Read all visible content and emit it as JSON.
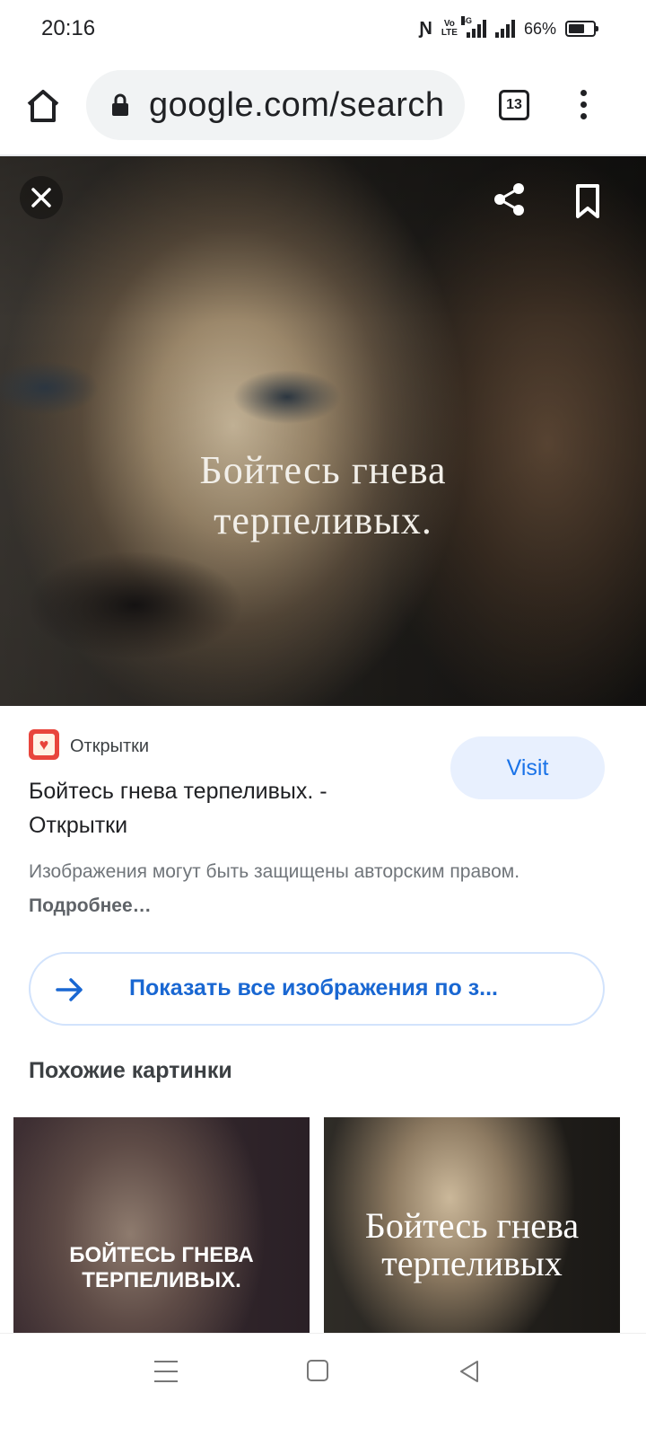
{
  "status_bar": {
    "time": "20:16",
    "network_label": "4G",
    "volte_label_top": "Vo",
    "volte_label_bottom": "LTE",
    "battery_text": "66%",
    "battery_level": 0.66
  },
  "browser": {
    "url_text": "google.com/search",
    "tab_count": "13",
    "icons": {
      "home": "home-icon",
      "lock": "lock-icon",
      "menu": "more-vert-icon"
    }
  },
  "image_viewer": {
    "caption_line1": "Бойтесь гнева",
    "caption_line2": "терпеливых.",
    "icons": {
      "close": "close-icon",
      "share": "share-icon",
      "save": "bookmark-icon"
    }
  },
  "result": {
    "source_name": "Открытки",
    "title": "Бойтесь гнева терпеливых. - Открытки",
    "visit_label": "Visit",
    "copyright_text": "Изображения могут быть защищены авторским правом.",
    "learn_more_label": "Подробнее…"
  },
  "show_all": {
    "label": "Показать все изображения по з..."
  },
  "similar": {
    "heading": "Похожие картинки",
    "items": [
      {
        "caption_line1": "БОЙТЕСЬ ГНЕВА",
        "caption_line2": "ТЕРПЕЛИВЫХ."
      },
      {
        "caption_line1": "Бойтесь гнева",
        "caption_line2": "терпеливых"
      }
    ]
  },
  "colors": {
    "accent": "#1a73e8",
    "visit_bg": "#e8f0fe",
    "source_icon": "#e8453c"
  }
}
